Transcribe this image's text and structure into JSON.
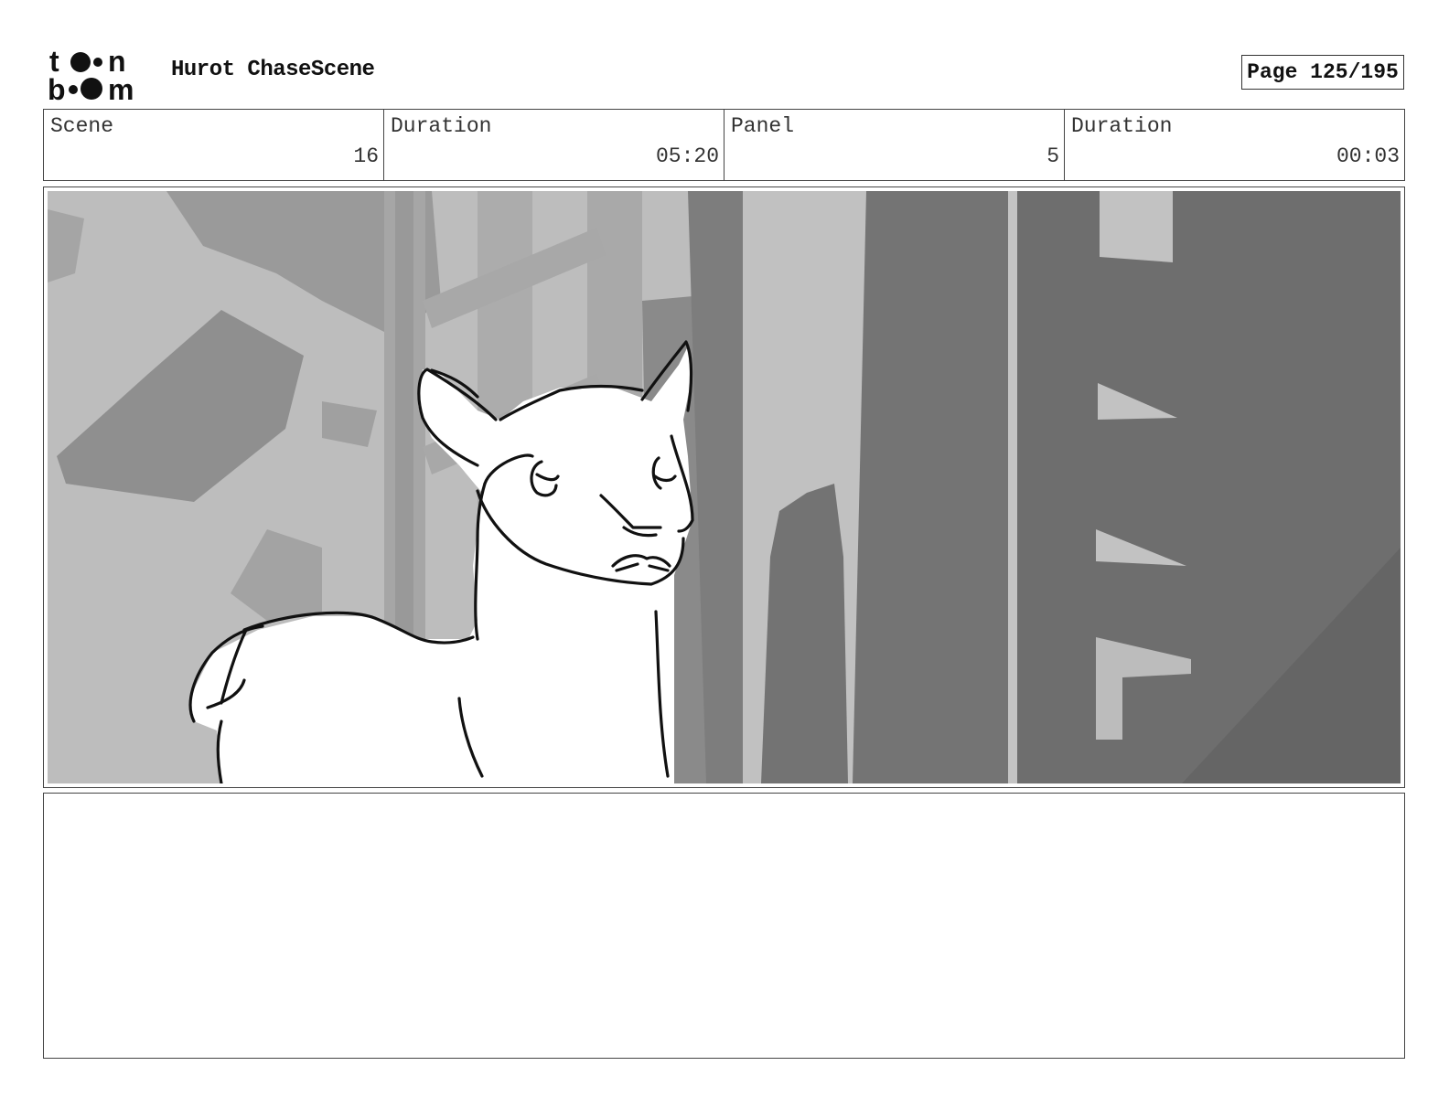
{
  "header": {
    "logo_text": "toon boom",
    "project_title": "Hurot ChaseScene",
    "page_label": "Page 125/195"
  },
  "info": {
    "scene_label": "Scene",
    "scene_value": "16",
    "scene_duration_label": "Duration",
    "scene_duration_value": "05:20",
    "panel_label": "Panel",
    "panel_value": "5",
    "panel_duration_label": "Duration",
    "panel_duration_value": "00:03"
  },
  "notes": {
    "text": ""
  }
}
